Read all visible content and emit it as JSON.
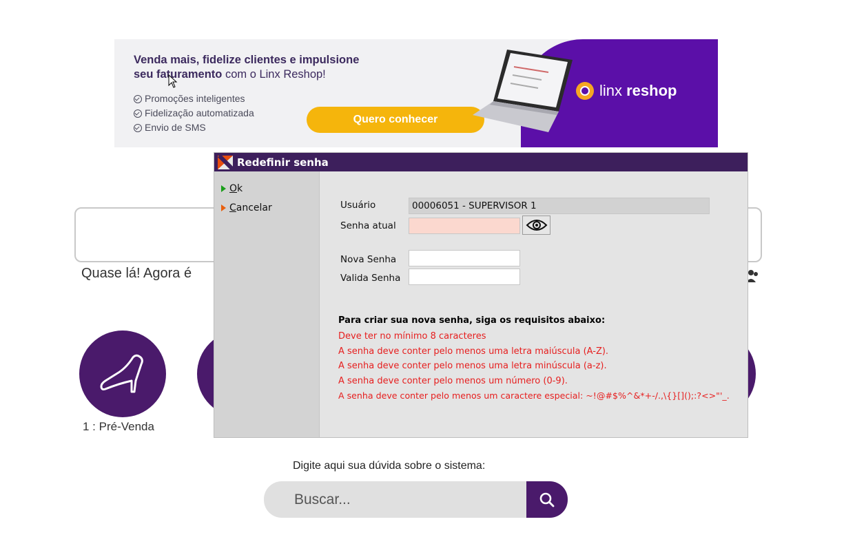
{
  "banner": {
    "headline_line1": "Venda mais, fidelize clientes e impulsione",
    "headline_bold": "seu faturamento",
    "headline_rest": " com o Linx Reshop!",
    "features": [
      "Promoções inteligentes",
      "Fidelização automatizada",
      "Envio de SMS"
    ],
    "cta_label": "Quero conhecer",
    "brand_light": "linx ",
    "brand_bold": "reshop"
  },
  "page": {
    "welcome_text": "Quase lá! Agora é",
    "module_label": "1 : Pré-Venda",
    "help_prompt": "Digite aqui sua dúvida sobre o sistema:",
    "search_placeholder": "Buscar..."
  },
  "dialog": {
    "title": "Redefinir senha",
    "actions": {
      "ok_key": "O",
      "ok_rest": "k",
      "cancel_key": "C",
      "cancel_rest": "ancelar"
    },
    "labels": {
      "usuario": "Usuário",
      "senha_atual": "Senha atual",
      "nova_senha": "Nova Senha",
      "valida_senha": "Valida Senha"
    },
    "values": {
      "usuario": "00006051 - SUPERVISOR 1",
      "senha_atual": "",
      "nova_senha": "",
      "valida_senha": ""
    },
    "requirements_title": "Para criar sua nova senha, siga os requisitos abaixo:",
    "requirements": [
      "Deve ter no mínimo 8 caracteres",
      "A senha deve conter pelo menos uma letra maiúscula (A-Z).",
      "A senha deve conter pelo menos uma letra minúscula (a-z).",
      "A senha deve conter pelo menos um número (0-9).",
      "A senha deve conter pelo menos um caractere especial: ~!@#$%^&*+-/.,\\{}[]();:?<>\"'_."
    ]
  },
  "colors": {
    "title_bar": "#3d1f5c",
    "accent_purple": "#4a1a6b",
    "cta_yellow": "#f5b50c",
    "requirement_red": "#e61e1e"
  }
}
